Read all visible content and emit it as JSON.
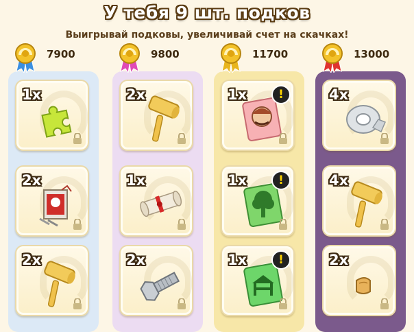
{
  "title": "У тебя 9 шт. подков",
  "subtitle": "Выигрывай подковы, увеличивай счет на скачках!",
  "columns": [
    {
      "price": "7900",
      "medal_color": "#3b8fe0",
      "bg": "#dce9f6",
      "slots": [
        {
          "qty": "1x",
          "item": "puzzle-piece-icon"
        },
        {
          "qty": "2x",
          "item": "nails-box-icon"
        },
        {
          "qty": "2x",
          "item": "mallet-icon"
        }
      ]
    },
    {
      "price": "9800",
      "medal_color": "#e04bb6",
      "bg": "#ecdcf2",
      "slots": [
        {
          "qty": "2x",
          "item": "mallet-icon"
        },
        {
          "qty": "1x",
          "item": "deed-scroll-icon"
        },
        {
          "qty": "2x",
          "item": "bolt-icon"
        }
      ]
    },
    {
      "price": "11700",
      "medal_color": "#e8b51e",
      "bg": "#f7e7a8",
      "slots": [
        {
          "qty": "1x",
          "item": "character-card-icon",
          "alert": "!"
        },
        {
          "qty": "1x",
          "item": "tree-card-icon",
          "alert": "!"
        },
        {
          "qty": "1x",
          "item": "fence-card-icon",
          "alert": "!"
        }
      ]
    },
    {
      "price": "13000",
      "medal_color": "#e0332f",
      "bg": "#7b5a8c",
      "slots": [
        {
          "qty": "4x",
          "item": "duct-tape-icon"
        },
        {
          "qty": "4x",
          "item": "mallet-icon"
        },
        {
          "qty": "2x",
          "item": "wood-plank-icon"
        }
      ]
    }
  ]
}
